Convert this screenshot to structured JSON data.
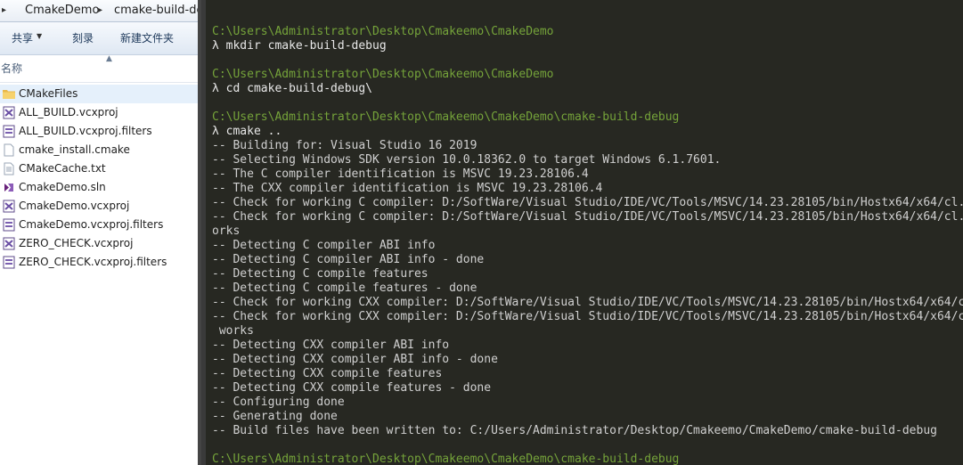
{
  "explorer": {
    "breadcrumb": [
      "CmakeDemo",
      "cmake-build-deb"
    ],
    "toolbar": {
      "share": "共享",
      "burn": "刻录",
      "new_folder": "新建文件夹"
    },
    "column_header": "名称",
    "files": [
      {
        "name": "CMakeFiles",
        "icon": "folder-icon",
        "selected": true
      },
      {
        "name": "ALL_BUILD.vcxproj",
        "icon": "vcxproj-icon"
      },
      {
        "name": "ALL_BUILD.vcxproj.filters",
        "icon": "filters-icon"
      },
      {
        "name": "cmake_install.cmake",
        "icon": "file-icon"
      },
      {
        "name": "CMakeCache.txt",
        "icon": "text-file-icon"
      },
      {
        "name": "CmakeDemo.sln",
        "icon": "sln-icon"
      },
      {
        "name": "CmakeDemo.vcxproj",
        "icon": "vcxproj-icon"
      },
      {
        "name": "CmakeDemo.vcxproj.filters",
        "icon": "filters-icon"
      },
      {
        "name": "ZERO_CHECK.vcxproj",
        "icon": "vcxproj-icon"
      },
      {
        "name": "ZERO_CHECK.vcxproj.filters",
        "icon": "filters-icon"
      }
    ]
  },
  "terminal": {
    "colors": {
      "background": "#272822",
      "path": "#75a33a",
      "text": "#d8d8d8"
    },
    "lines": [
      {
        "kind": "path",
        "text": "C:\\Users\\Administrator\\Desktop\\Cmakeemo\\CmakeDemo"
      },
      {
        "kind": "cmd",
        "text": "λ mkdir cmake-build-debug"
      },
      {
        "kind": "blank",
        "text": ""
      },
      {
        "kind": "path",
        "text": "C:\\Users\\Administrator\\Desktop\\Cmakeemo\\CmakeDemo"
      },
      {
        "kind": "cmd",
        "text": "λ cd cmake-build-debug\\"
      },
      {
        "kind": "blank",
        "text": ""
      },
      {
        "kind": "path",
        "text": "C:\\Users\\Administrator\\Desktop\\Cmakeemo\\CmakeDemo\\cmake-build-debug"
      },
      {
        "kind": "cmd",
        "text": "λ cmake .."
      },
      {
        "kind": "out",
        "text": "-- Building for: Visual Studio 16 2019"
      },
      {
        "kind": "out",
        "text": "-- Selecting Windows SDK version 10.0.18362.0 to target Windows 6.1.7601."
      },
      {
        "kind": "out",
        "text": "-- The C compiler identification is MSVC 19.23.28106.4"
      },
      {
        "kind": "out",
        "text": "-- The CXX compiler identification is MSVC 19.23.28106.4"
      },
      {
        "kind": "out",
        "text": "-- Check for working C compiler: D:/SoftWare/Visual Studio/IDE/VC/Tools/MSVC/14.23.28105/bin/Hostx64/x64/cl.exe"
      },
      {
        "kind": "out",
        "text": "-- Check for working C compiler: D:/SoftWare/Visual Studio/IDE/VC/Tools/MSVC/14.23.28105/bin/Hostx64/x64/cl.exe -- w"
      },
      {
        "kind": "out",
        "text": "orks"
      },
      {
        "kind": "out",
        "text": "-- Detecting C compiler ABI info"
      },
      {
        "kind": "out",
        "text": "-- Detecting C compiler ABI info - done"
      },
      {
        "kind": "out",
        "text": "-- Detecting C compile features"
      },
      {
        "kind": "out",
        "text": "-- Detecting C compile features - done"
      },
      {
        "kind": "out",
        "text": "-- Check for working CXX compiler: D:/SoftWare/Visual Studio/IDE/VC/Tools/MSVC/14.23.28105/bin/Hostx64/x64/cl.exe"
      },
      {
        "kind": "out",
        "text": "-- Check for working CXX compiler: D:/SoftWare/Visual Studio/IDE/VC/Tools/MSVC/14.23.28105/bin/Hostx64/x64/cl.exe --"
      },
      {
        "kind": "out",
        "text": " works"
      },
      {
        "kind": "out",
        "text": "-- Detecting CXX compiler ABI info"
      },
      {
        "kind": "out",
        "text": "-- Detecting CXX compiler ABI info - done"
      },
      {
        "kind": "out",
        "text": "-- Detecting CXX compile features"
      },
      {
        "kind": "out",
        "text": "-- Detecting CXX compile features - done"
      },
      {
        "kind": "out",
        "text": "-- Configuring done"
      },
      {
        "kind": "out",
        "text": "-- Generating done"
      },
      {
        "kind": "out",
        "text": "-- Build files have been written to: C:/Users/Administrator/Desktop/Cmakeemo/CmakeDemo/cmake-build-debug"
      },
      {
        "kind": "blank",
        "text": ""
      },
      {
        "kind": "path",
        "text": "C:\\Users\\Administrator\\Desktop\\Cmakeemo\\CmakeDemo\\cmake-build-debug"
      }
    ]
  }
}
